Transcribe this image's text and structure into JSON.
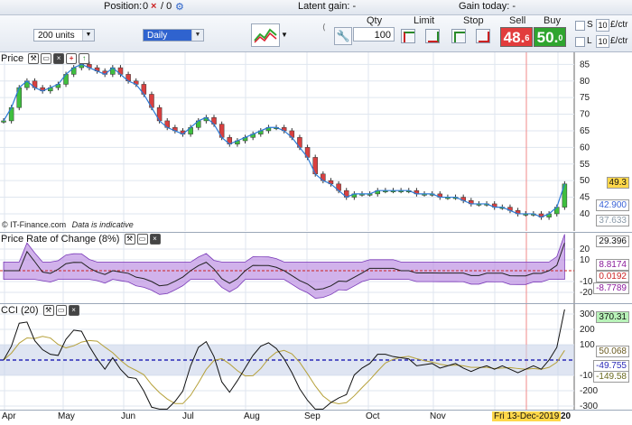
{
  "top": {
    "position_label": "Position:",
    "position_qty": "0",
    "position_sep": "/ 0",
    "latent_label": "Latent gain: -",
    "today_label": "Gain today: -"
  },
  "toolbar": {
    "units_value": "200 units",
    "period_value": "Daily",
    "qty_header": "Qty",
    "qty_value": "100",
    "limit_header": "Limit",
    "stop_header": "Stop",
    "sell_header": "Sell",
    "buy_header": "Buy",
    "sell_price_main": "48.",
    "sell_price_frac": "6",
    "buy_price_main": "50.",
    "buy_price_frac": "0",
    "s_label": "S",
    "l_label": "L",
    "s_value": "10",
    "l_value": "10",
    "unit_label": "£/ctr",
    "colors": {
      "sell": "#e23c3c",
      "buy": "#2fa52f"
    }
  },
  "price_panel": {
    "title": "Price",
    "watermark": "© IT-Finance.com",
    "watermark_note": "Data is indicative",
    "axis_labels": [
      "85",
      "80",
      "75",
      "70",
      "65",
      "60",
      "55",
      "50",
      "45",
      "40"
    ],
    "last_price": "49.3",
    "level_1": "42.900",
    "level_2": "37.633"
  },
  "roc_panel": {
    "title": "Price Rate of Change (8%)",
    "axis_labels": [
      "20",
      "10",
      "-10",
      "-20"
    ],
    "tag_1": "29.396",
    "tag_2": "8.8174",
    "tag_3": "0.0192",
    "tag_4": "-8.7789"
  },
  "cci_panel": {
    "title": "CCI (20)",
    "axis_labels": [
      "300",
      "200",
      "100",
      "-100",
      "-200",
      "-300"
    ],
    "tag_1": "370.31",
    "tag_2": "50.068",
    "tag_3": "-49.755",
    "tag_4": "-149.58"
  },
  "xaxis": {
    "months": [
      "Apr",
      "May",
      "Jun",
      "Jul",
      "Aug",
      "Sep",
      "Oct",
      "Nov"
    ],
    "cursor_date": "Fri 13-Dec-2019",
    "year_tail": "20"
  },
  "chart_data": {
    "type": "candlestick",
    "ylim": [
      37,
      87
    ],
    "closes": [
      68,
      72,
      78,
      80,
      78,
      77,
      78,
      79,
      82,
      84,
      85,
      84,
      83,
      82,
      84,
      82,
      80,
      79,
      76,
      72,
      68,
      66,
      65,
      64,
      66,
      68,
      69,
      67,
      63,
      61,
      62,
      63,
      64,
      65,
      66,
      66,
      65,
      63,
      60,
      57,
      52,
      50,
      49,
      47,
      45,
      46,
      46,
      46,
      47,
      47,
      47,
      47,
      47,
      46,
      46,
      46,
      45,
      45,
      45,
      44,
      43,
      43,
      43,
      42,
      42,
      41,
      40,
      40,
      40,
      39,
      40,
      42,
      49
    ]
  }
}
